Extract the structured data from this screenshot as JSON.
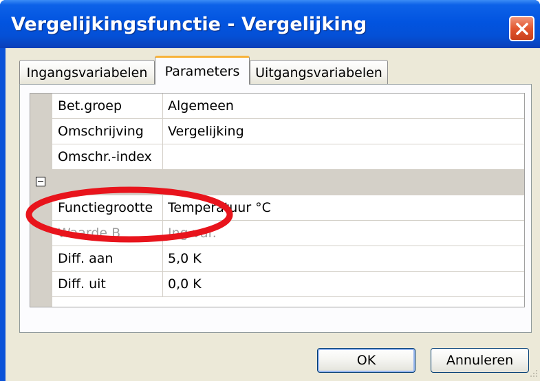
{
  "window": {
    "title": "Vergelijkingsfunctie - Vergelijking"
  },
  "tabs": [
    {
      "label": "Ingangsvariabelen",
      "active": false
    },
    {
      "label": "Parameters",
      "active": true
    },
    {
      "label": "Uitgangsvariabelen",
      "active": false
    }
  ],
  "properties": [
    {
      "name": "Bet.groep",
      "value": "Algemeen",
      "disabled": false
    },
    {
      "name": "Omschrijving",
      "value": "Vergelijking",
      "disabled": false
    },
    {
      "name": "Omschr.-index",
      "value": "",
      "disabled": false
    },
    {
      "name": "Functiegrootte",
      "value": "Temperatuur °C",
      "disabled": false
    },
    {
      "name": "Waarde B",
      "value": "Ing.var.",
      "disabled": true
    },
    {
      "name": "Diff. aan",
      "value": "5,0 K",
      "disabled": false
    },
    {
      "name": "Diff. uit",
      "value": "0,0 K",
      "disabled": false
    }
  ],
  "buttons": {
    "ok": "OK",
    "cancel": "Annuleren"
  },
  "colors": {
    "highlight_ellipse": "#e8141c",
    "title_bar": "#0254e0",
    "dialog_bg": "#ece9d8",
    "active_tab_accent": "#f8b33a"
  },
  "icons": {
    "close": "close-icon",
    "collapse": "collapse-minus-icon",
    "resize_grip": "resize-grip-icon"
  }
}
